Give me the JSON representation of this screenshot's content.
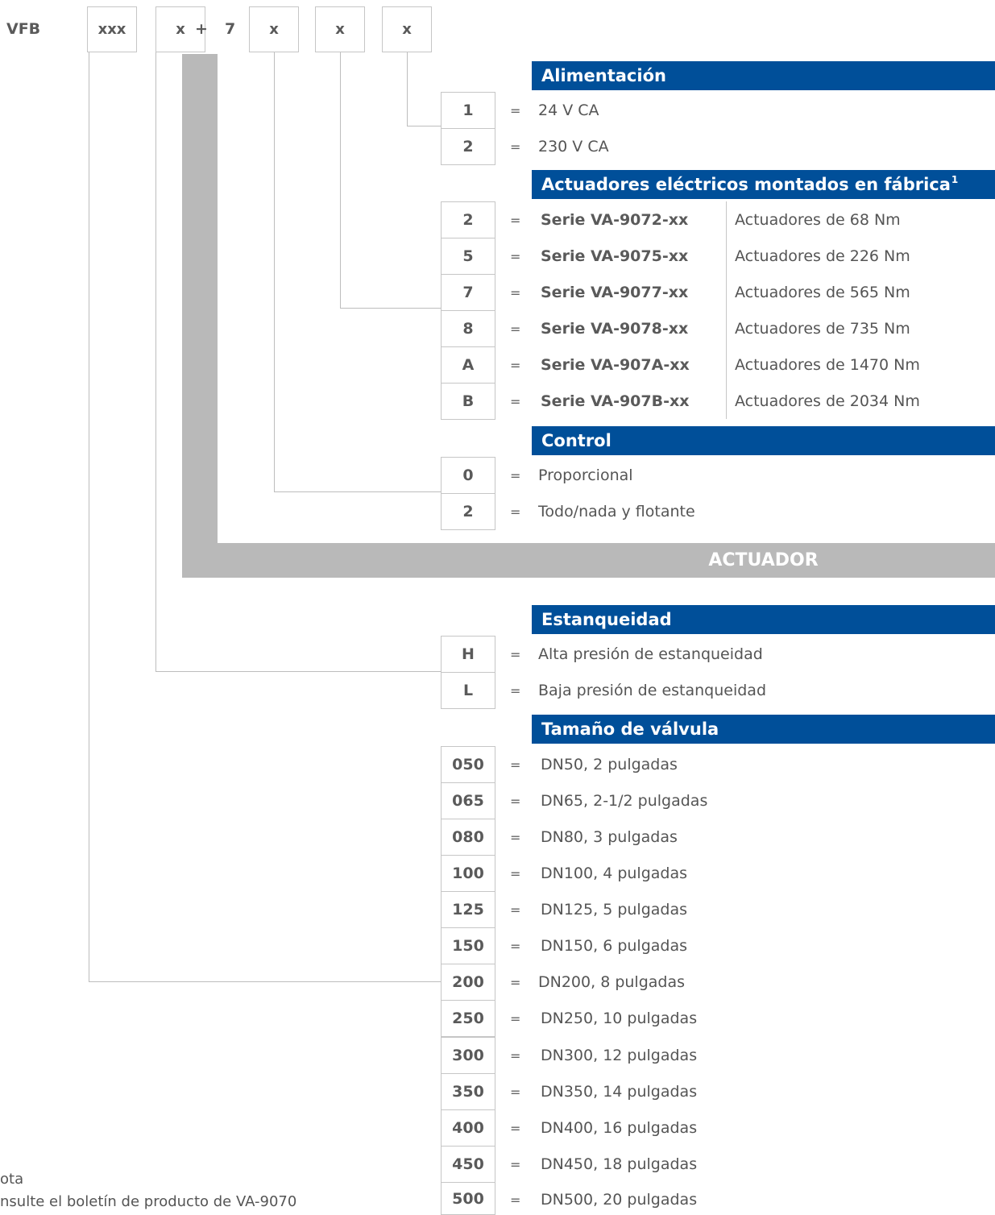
{
  "code": {
    "prefix": "VFB",
    "boxes": [
      "xxx",
      "x",
      "x",
      "x",
      "x"
    ],
    "plus": "+",
    "seven": "7"
  },
  "alimentacion": {
    "title": "Alimentación",
    "rows": [
      {
        "code": "1",
        "eq": "=",
        "text": "24 V CA"
      },
      {
        "code": "2",
        "eq": "=",
        "text": "230 V CA"
      }
    ]
  },
  "actuadores": {
    "title": "Actuadores eléctricos montados en fábrica",
    "sup": "1",
    "rows": [
      {
        "code": "2",
        "eq": "=",
        "series": "Serie VA-9072-xx",
        "text": "Actuadores de 68 Nm"
      },
      {
        "code": "5",
        "eq": "=",
        "series": "Serie VA-9075-xx",
        "text": "Actuadores de 226 Nm"
      },
      {
        "code": "7",
        "eq": "=",
        "series": "Serie VA-9077-xx",
        "text": "Actuadores de 565 Nm"
      },
      {
        "code": "8",
        "eq": "=",
        "series": "Serie VA-9078-xx",
        "text": "Actuadores de 735 Nm"
      },
      {
        "code": "A",
        "eq": "=",
        "series": "Serie VA-907A-xx",
        "text": "Actuadores de 1470 Nm"
      },
      {
        "code": "B",
        "eq": "=",
        "series": "Serie VA-907B-xx",
        "text": "Actuadores de 2034 Nm"
      }
    ]
  },
  "control": {
    "title": "Control",
    "rows": [
      {
        "code": "0",
        "eq": "=",
        "text": "Proporcional"
      },
      {
        "code": "2",
        "eq": "=",
        "text": "Todo/nada y flotante"
      }
    ]
  },
  "actuador_banner": "ACTUADOR",
  "estanqueidad": {
    "title": "Estanqueidad",
    "rows": [
      {
        "code": "H",
        "eq": "=",
        "text": "Alta presión de estanqueidad"
      },
      {
        "code": "L",
        "eq": "=",
        "text": "Baja presión de estanqueidad"
      }
    ]
  },
  "tamano": {
    "title": "Tamaño de válvula",
    "rows": [
      {
        "code": "050",
        "eq": "=",
        "text": "DN50, 2 pulgadas"
      },
      {
        "code": "065",
        "eq": "=",
        "text": "DN65, 2-1/2 pulgadas"
      },
      {
        "code": "080",
        "eq": "=",
        "text": "DN80, 3 pulgadas"
      },
      {
        "code": "100",
        "eq": "=",
        "text": "DN100, 4 pulgadas"
      },
      {
        "code": "125",
        "eq": "=",
        "text": "DN125, 5 pulgadas"
      },
      {
        "code": "150",
        "eq": "=",
        "text": "DN150, 6 pulgadas"
      },
      {
        "code": "200",
        "eq": "=",
        "text": "DN200, 8 pulgadas"
      },
      {
        "code": "250",
        "eq": "=",
        "text": "DN250, 10 pulgadas"
      },
      {
        "code": "300",
        "eq": "=",
        "text": "DN300, 12 pulgadas"
      },
      {
        "code": "350",
        "eq": "=",
        "text": "DN350, 14 pulgadas"
      },
      {
        "code": "400",
        "eq": "=",
        "text": "DN400, 16 pulgadas"
      },
      {
        "code": "450",
        "eq": "=",
        "text": "DN450, 18 pulgadas"
      },
      {
        "code": "500",
        "eq": "=",
        "text": "DN500, 20 pulgadas"
      }
    ]
  },
  "note": {
    "title": "ota",
    "text": "nsulte el boletín de producto de VA-9070"
  }
}
